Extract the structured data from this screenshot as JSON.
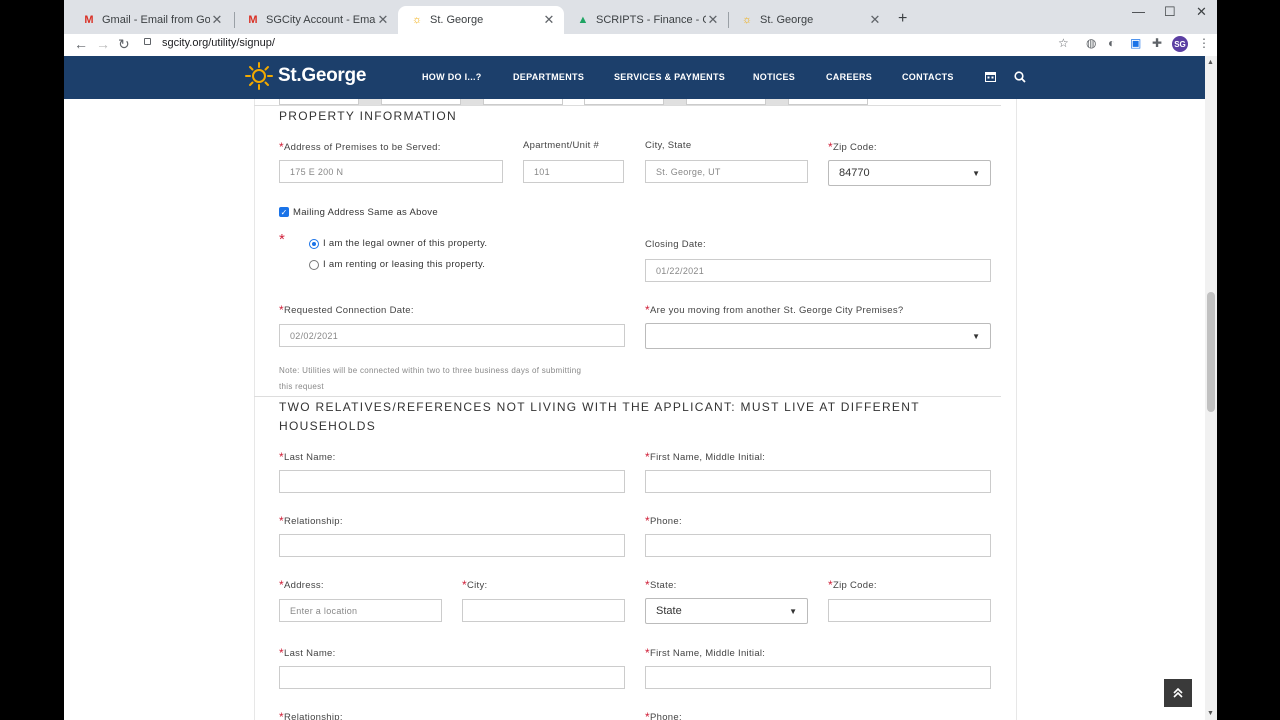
{
  "browser": {
    "tabs": [
      {
        "title": "Gmail - Email from Google",
        "icon": "gmail-icon"
      },
      {
        "title": "SGCity Account - Email Verificatio",
        "icon": "gmail-icon"
      },
      {
        "title": "St. George",
        "icon": "sun-icon"
      },
      {
        "title": "SCRIPTS - Finance - Google Drive",
        "icon": "drive-icon"
      },
      {
        "title": "St. George",
        "icon": "sun-icon"
      }
    ],
    "url": "sgcity.org/utility/signup/",
    "profile_initials": "SG"
  },
  "site": {
    "logo_text": "St.George",
    "nav": [
      "HOW DO I...?",
      "DEPARTMENTS",
      "SERVICES & PAYMENTS",
      "NOTICES",
      "CAREERS",
      "CONTACTS"
    ]
  },
  "property": {
    "title": "PROPERTY INFORMATION",
    "address_label": "Address of Premises to be Served:",
    "address_value": "175 E 200 N",
    "unit_label": "Apartment/Unit #",
    "unit_value": "101",
    "city_label": "City, State",
    "city_value": "St. George, UT",
    "zip_label": "Zip Code:",
    "zip_value": "84770",
    "mailing_same_label": "Mailing Address Same as Above",
    "owner_option": "I am the legal owner of this property.",
    "renting_option": "I am renting or leasing this property.",
    "closing_label": "Closing Date:",
    "closing_value": "01/22/2021",
    "connection_label": "Requested Connection Date:",
    "connection_value": "02/02/2021",
    "moving_label": "Are you moving from another St. George City Premises?",
    "moving_value": "",
    "note_line1": "Note: Utilities will be connected within two to three business days of submitting",
    "note_line2": "this request"
  },
  "references": {
    "title_line1": "TWO RELATIVES/REFERENCES NOT LIVING WITH THE APPLICANT: MUST LIVE AT DIFFERENT",
    "title_line2": "HOUSEHOLDS",
    "last_name_label": "Last Name:",
    "first_name_label": "First Name, Middle Initial:",
    "relationship_label": "Relationship:",
    "phone_label": "Phone:",
    "address_label": "Address:",
    "address_placeholder": "Enter a location",
    "city_label": "City:",
    "state_label": "State:",
    "state_value": "State",
    "zip_label": "Zip Code:"
  },
  "colors": {
    "header_bg": "#1c3f6b",
    "required": "#d0213a",
    "accent": "#1a73e8"
  }
}
